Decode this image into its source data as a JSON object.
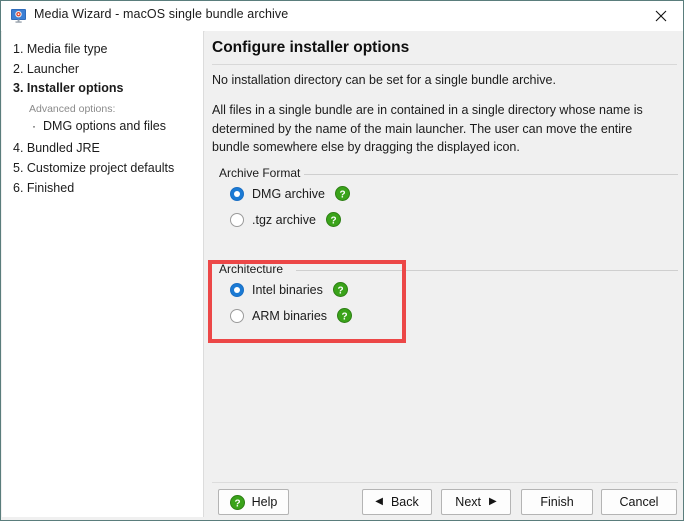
{
  "window": {
    "title": "Media Wizard - macOS single bundle archive",
    "icon": "monitor-icon",
    "close_icon": "close-icon",
    "accent_selected": "#1b7ad4",
    "highlight_color": "#ec4747",
    "help_icon_color": "#3aa31a"
  },
  "sidebar": {
    "steps": [
      {
        "label": "1. Media file type",
        "current": false
      },
      {
        "label": "2. Launcher",
        "current": false
      },
      {
        "label": "3. Installer options",
        "current": true
      }
    ],
    "advanced_label": "Advanced options:",
    "advanced_items": [
      {
        "bullet": "·",
        "label": "DMG options and files"
      }
    ],
    "steps_after": [
      {
        "label": "4. Bundled JRE",
        "current": false
      },
      {
        "label": "5. Customize project defaults",
        "current": false
      },
      {
        "label": "6. Finished",
        "current": false
      }
    ]
  },
  "main": {
    "title": "Configure installer options",
    "description_1": "No installation directory can be set for a single bundle archive.",
    "description_2": "All files in a single bundle are in contained in a single directory whose name is determined by the name of the main launcher. The user can move the entire bundle somewhere else by dragging the displayed icon.",
    "groups": [
      {
        "legend": "Archive Format",
        "options": [
          {
            "label": "DMG archive",
            "selected": true,
            "help": "help-icon"
          },
          {
            "label": ".tgz archive",
            "selected": false,
            "help": "help-icon"
          }
        ]
      },
      {
        "legend": "Architecture",
        "highlighted": true,
        "options": [
          {
            "label": "Intel binaries",
            "selected": true,
            "help": "help-icon"
          },
          {
            "label": "ARM binaries",
            "selected": false,
            "help": "help-icon"
          }
        ]
      }
    ]
  },
  "footer": {
    "help": "Help",
    "back": "Back",
    "back_arrow": "◀",
    "next": "Next",
    "next_arrow": "▶",
    "finish": "Finish",
    "cancel": "Cancel"
  }
}
